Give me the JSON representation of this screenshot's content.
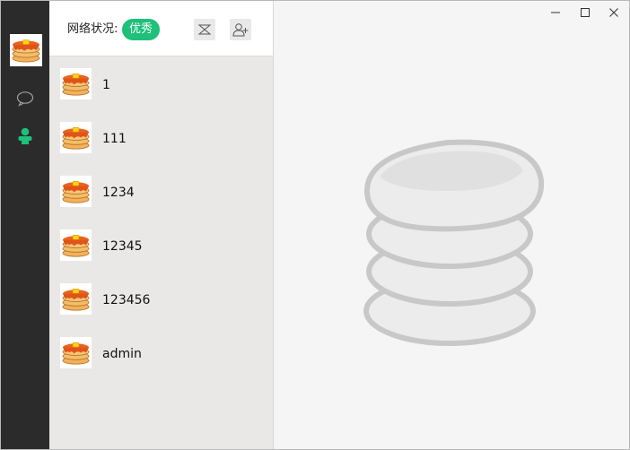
{
  "network": {
    "label": "网络状况:",
    "quality": "优秀"
  },
  "header_buttons": [
    "mass-message-icon",
    "add-contact-icon"
  ],
  "rail": {
    "icons": [
      "chat-bubble-icon",
      "contacts-icon"
    ],
    "active": "contacts-icon"
  },
  "contacts": [
    {
      "name": "1"
    },
    {
      "name": "111"
    },
    {
      "name": "1234"
    },
    {
      "name": "12345"
    },
    {
      "name": "123456"
    },
    {
      "name": "admin"
    }
  ],
  "colors": {
    "accent": "#1ec07a",
    "rail_bg": "#2b2b2b",
    "list_bg": "#eae8e7",
    "content_bg": "#f5f5f5"
  }
}
